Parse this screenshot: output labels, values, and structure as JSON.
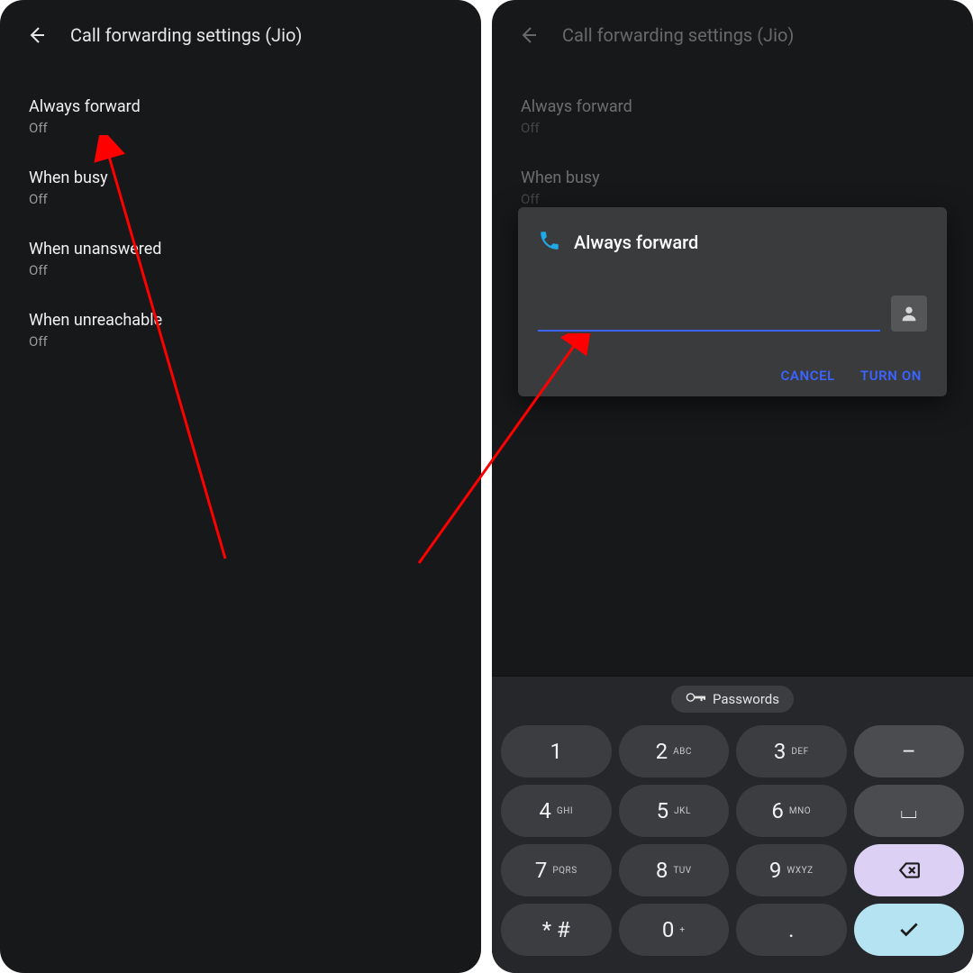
{
  "header": {
    "title": "Call forwarding settings (Jio)"
  },
  "settings": [
    {
      "title": "Always forward",
      "sub": "Off"
    },
    {
      "title": "When busy",
      "sub": "Off"
    },
    {
      "title": "When unanswered",
      "sub": "Off"
    },
    {
      "title": "When unreachable",
      "sub": "Off"
    }
  ],
  "dialog": {
    "title": "Always forward",
    "input_value": "",
    "cancel": "CANCEL",
    "turn_on": "TURN ON"
  },
  "keyboard": {
    "chip": "Passwords",
    "keys": [
      {
        "d": "1",
        "l": ""
      },
      {
        "d": "2",
        "l": "ABC"
      },
      {
        "d": "3",
        "l": "DEF"
      },
      {
        "d": "–",
        "l": "",
        "side": true
      },
      {
        "d": "4",
        "l": "GHI"
      },
      {
        "d": "5",
        "l": "JKL"
      },
      {
        "d": "6",
        "l": "MNO"
      },
      {
        "d": "⌴",
        "l": "",
        "side": true
      },
      {
        "d": "7",
        "l": "PQRS"
      },
      {
        "d": "8",
        "l": "TUV"
      },
      {
        "d": "9",
        "l": "WXYZ"
      },
      {
        "d": "⌫",
        "l": "",
        "lav": true
      },
      {
        "d": "* #",
        "l": ""
      },
      {
        "d": "0",
        "l": "+"
      },
      {
        "d": ".",
        "l": ""
      },
      {
        "d": "✓",
        "l": "",
        "cyan": true
      }
    ]
  },
  "annotation": {
    "arrow_color": "#ff0000"
  }
}
